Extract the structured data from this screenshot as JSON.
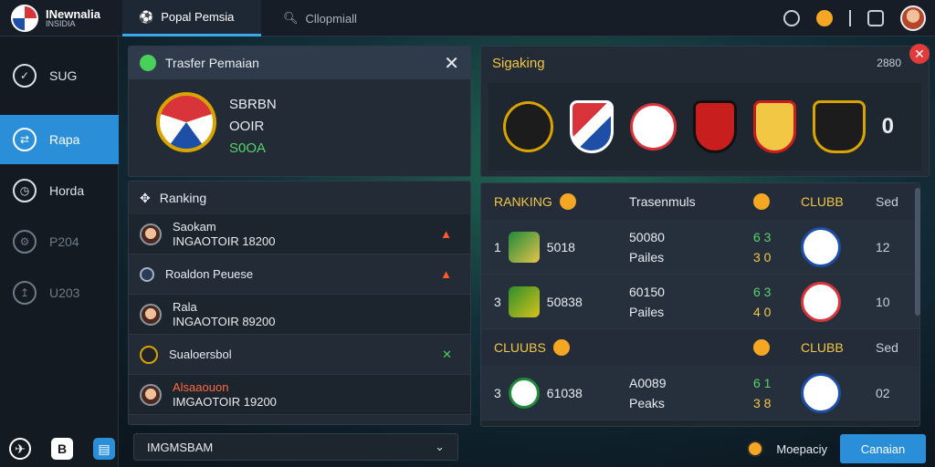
{
  "app": {
    "title": "INewnalia",
    "subtitle": "INSIDIA"
  },
  "tabs": [
    {
      "label": "Popal Pemsia",
      "icon": "soccer-icon"
    },
    {
      "label": "Cllopmiall",
      "icon": "search-icon"
    }
  ],
  "sidebar": {
    "items": [
      {
        "label": "SUG",
        "icon": "check-icon"
      },
      {
        "label": "Rapa",
        "icon": "transfer-icon"
      },
      {
        "label": "Horda",
        "icon": "clock-icon"
      },
      {
        "label": "P204",
        "icon": "settings-icon"
      },
      {
        "label": "U203",
        "icon": "upload-icon"
      }
    ],
    "footer_icons": [
      "run-icon",
      "b-icon",
      "calendar-icon"
    ]
  },
  "transfer": {
    "title": "Trasfer Pemaian",
    "lines": [
      "SBRBN",
      "OOIR",
      "S0OA"
    ]
  },
  "ranking_panel": {
    "title": "Ranking",
    "rows": [
      {
        "name": "Saokam",
        "detail": "INGAOTOIR 18200"
      },
      {
        "name": "Roaldon Peuese",
        "detail": ""
      },
      {
        "name": "Rala",
        "detail": "INGAOTOIR 89200"
      },
      {
        "name": "Sualoersbol",
        "detail": ""
      },
      {
        "name": "Alsaaouon",
        "detail": "IMGAOTOIR 19200"
      }
    ]
  },
  "dropdown": {
    "value": "IMGMSBAM"
  },
  "speaking": {
    "title": "Sigaking",
    "count": "2880",
    "value": "0"
  },
  "standings": {
    "header1": {
      "a": "RANKING",
      "b": "Trasenmuls",
      "c": "CLUBB",
      "d": "Sed"
    },
    "header2": {
      "a": "CLUUBS",
      "c": "CLUBB",
      "d": "Sed"
    },
    "rows": [
      {
        "rank": "1",
        "code": "5018",
        "val": "50080",
        "sub": "Pailes",
        "g": "6 3",
        "y": "3 0",
        "score": "12"
      },
      {
        "rank": "3",
        "code": "50838",
        "val": "60150",
        "sub": "Pailes",
        "g": "6 3",
        "y": "4 0",
        "score": "10"
      },
      {
        "rank": "3",
        "code": "61038",
        "val": "A0089",
        "sub": "Peaks",
        "g": "6 1",
        "y": "3 8",
        "score": "02"
      }
    ]
  },
  "footer": {
    "status": "Moepaciy",
    "button": "Canaian"
  }
}
